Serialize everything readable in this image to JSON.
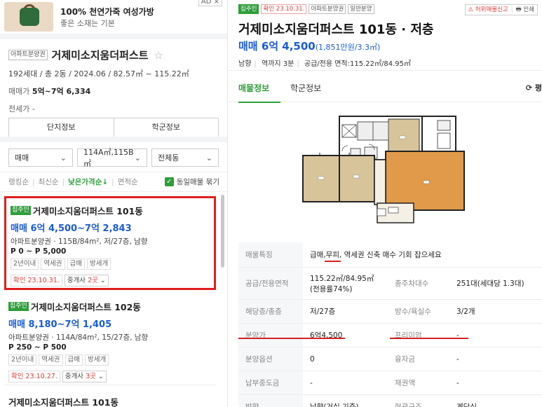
{
  "ad": {
    "title": "100% 천연가죽 여성가방",
    "subtitle": "좋은 소재는 기본",
    "badge": "AD ×"
  },
  "complex": {
    "tag": "아파트분양권",
    "name": "거제미소지움더퍼스트",
    "star": "☆",
    "info": "192세대 / 총 2동 / 2024.06 / 82.57㎡ ~ 115.22㎡",
    "sale_label": "매매가",
    "sale_value": "5억~7억 6,334",
    "jeonse": "전세가 -",
    "btn_complex": "단지정보",
    "btn_school": "학군정보"
  },
  "filters": {
    "type": "매매",
    "area": "114A㎡,115B㎡",
    "dong": "전체동",
    "chevron": "⌄"
  },
  "sort": {
    "ranking": "랭킹순",
    "latest": "최신순",
    "low_price": "낮은가격순↓",
    "area": "면적순",
    "same_listing": "동일매물 묶기",
    "check": "✓"
  },
  "listings": [
    {
      "tag": "집주인",
      "name": "거제미소지움더퍼스트 101동",
      "price": "매매 6억 4,500~7억 2,843",
      "desc": "아파트분양권 · 115B/84m², 저/27층, 남향",
      "premium": "P 0 ~ P 5,000",
      "chips": [
        "2년이내",
        "역세권",
        "급매",
        "방세개"
      ],
      "confirm": "확인 23.10.31.",
      "agent_prefix": "중개사 ",
      "agent_count": "2곳",
      "agent_suffix": " ⌄"
    },
    {
      "tag": "집주인",
      "name": "거제미소지움더퍼스트 102동",
      "price": "매매 8,180~7억 1,405",
      "desc": "아파트분양권 · 114A/84m², 15/27층, 남향",
      "premium": "P 250 ~ P 500",
      "chips": [
        "2년이내",
        "역세권",
        "급매",
        "방세개"
      ],
      "confirm": "확인 23.10.27.",
      "agent_prefix": "중개사 ",
      "agent_count": "3곳",
      "agent_suffix": " ⌄"
    },
    {
      "name": "거제미소지움더퍼스트 101동"
    }
  ],
  "detail": {
    "tags": [
      "집주인",
      "확인 23.10.31.",
      "아파트분양권",
      "일반분양"
    ],
    "report": "허위매물신고",
    "print": "인쇄",
    "title": "거제미소지움더퍼스트 101동 · 저층",
    "price": "매매 6억 4,500",
    "price_per": "(1,851만원/3.3㎡)",
    "direction": "남향",
    "station": "역까지 3분",
    "area_info": "공급/전용 면적:115.22㎡/84.95㎡",
    "tab_listing": "매물정보",
    "tab_school": "학군정보",
    "sort_label": "⟳ 평"
  },
  "table": {
    "feature_label": "매물특징",
    "feature_pre": "급매, ",
    "feature_mp": "무피",
    "feature_post": ", 역세권 신축 매수 기회 잡으세요",
    "area_label": "공급/전용면적",
    "area_value": "115.22㎡/84.95㎡(전용률74%)",
    "households_label": "총주차대수",
    "households_value": "251대(세대당 1.3대)",
    "floor_label": "해당층/총층",
    "floor_value": "저/27층",
    "rooms_label": "방수/욕실수",
    "rooms_value": "3/2개",
    "presale_label": "분양가",
    "presale_value": "6억4,500",
    "premium_label": "프리미엄",
    "premium_value": "-",
    "option_label": "분양옵션",
    "option_value": "0",
    "loan_label": "융자금",
    "loan_value": "-",
    "paid_label": "납부중도금",
    "paid_value": "-",
    "bond_label": "채권액",
    "bond_value": "-",
    "direction_label": "방향",
    "direction_value": "남향(거실 기준)",
    "entrance_label": "현관구조",
    "entrance_value": "계단식"
  }
}
